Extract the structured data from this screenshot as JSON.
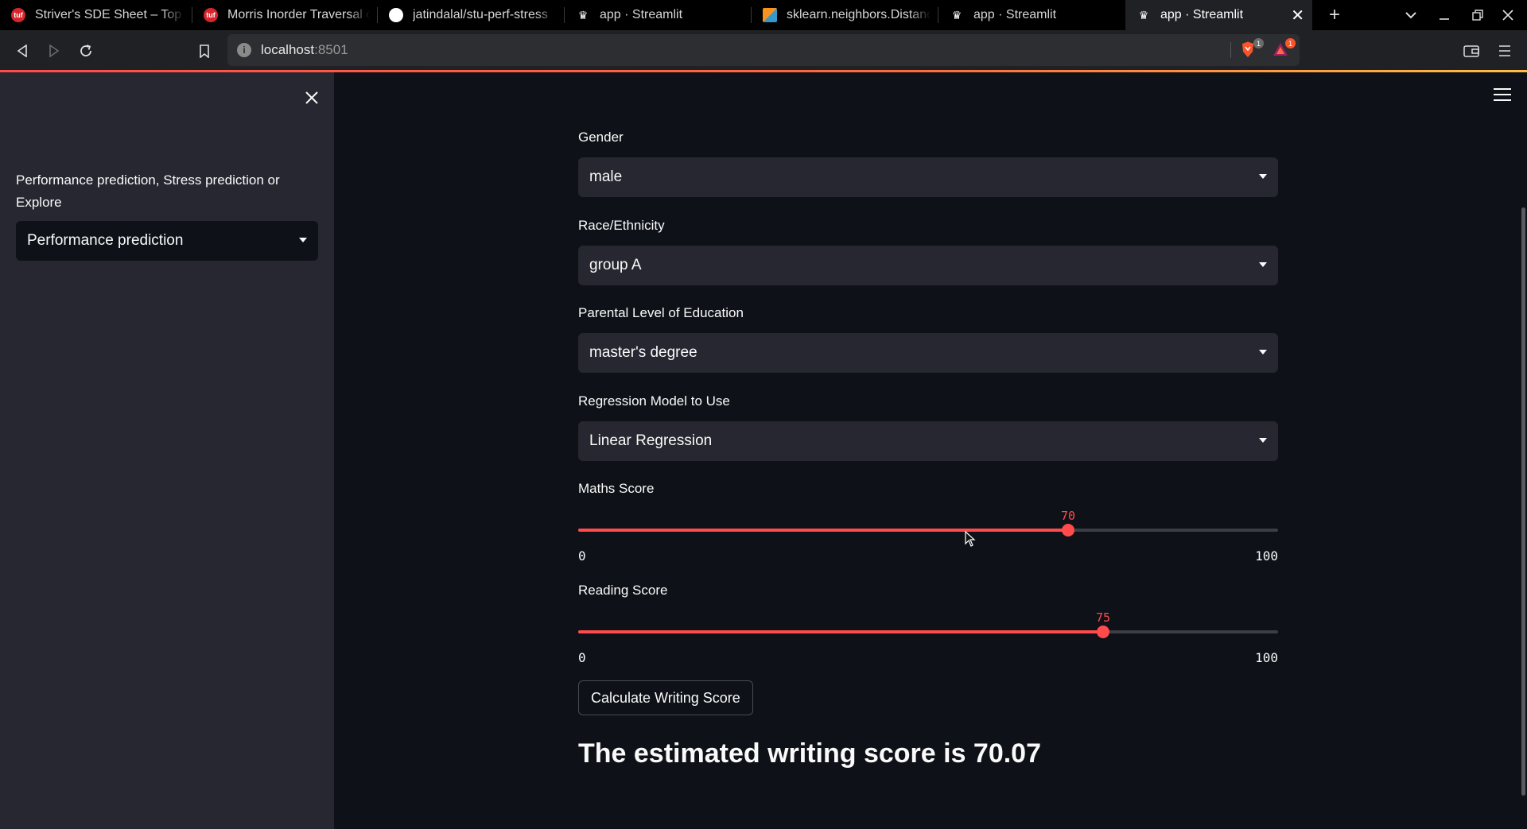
{
  "browser": {
    "tabs": [
      {
        "title": "Striver's SDE Sheet – Top",
        "favicon": "tuf-logo"
      },
      {
        "title": "Morris Inorder Traversal of",
        "favicon": "tuf-logo"
      },
      {
        "title": "jatindalal/stu-perf-stress",
        "favicon": "github-logo"
      },
      {
        "title": "app · Streamlit",
        "favicon": "streamlit-logo"
      },
      {
        "title": "sklearn.neighbors.Distance",
        "favicon": "sklearn-logo"
      },
      {
        "title": "app · Streamlit",
        "favicon": "streamlit-logo"
      },
      {
        "title": "app · Streamlit",
        "favicon": "streamlit-logo",
        "active": true
      }
    ],
    "url_host": "localhost",
    "url_port": ":8501",
    "brave_badge": "1",
    "rewards_badge": "1",
    "accent_color": "#ff4b4b"
  },
  "sidebar": {
    "select_label": "Performance prediction, Stress prediction or Explore",
    "selected_value": "Performance prediction"
  },
  "form": {
    "gender": {
      "label": "Gender",
      "value": "male"
    },
    "race": {
      "label": "Race/Ethnicity",
      "value": "group A"
    },
    "education": {
      "label": "Parental Level of Education",
      "value": "master's degree"
    },
    "model": {
      "label": "Regression Model to Use",
      "value": "Linear Regression"
    },
    "maths": {
      "label": "Maths Score",
      "value": "70",
      "min": "0",
      "max": "100"
    },
    "reading": {
      "label": "Reading Score",
      "value": "75",
      "min": "0",
      "max": "100"
    },
    "button_label": "Calculate Writing Score",
    "result_text": "The estimated writing score is 70.07"
  }
}
